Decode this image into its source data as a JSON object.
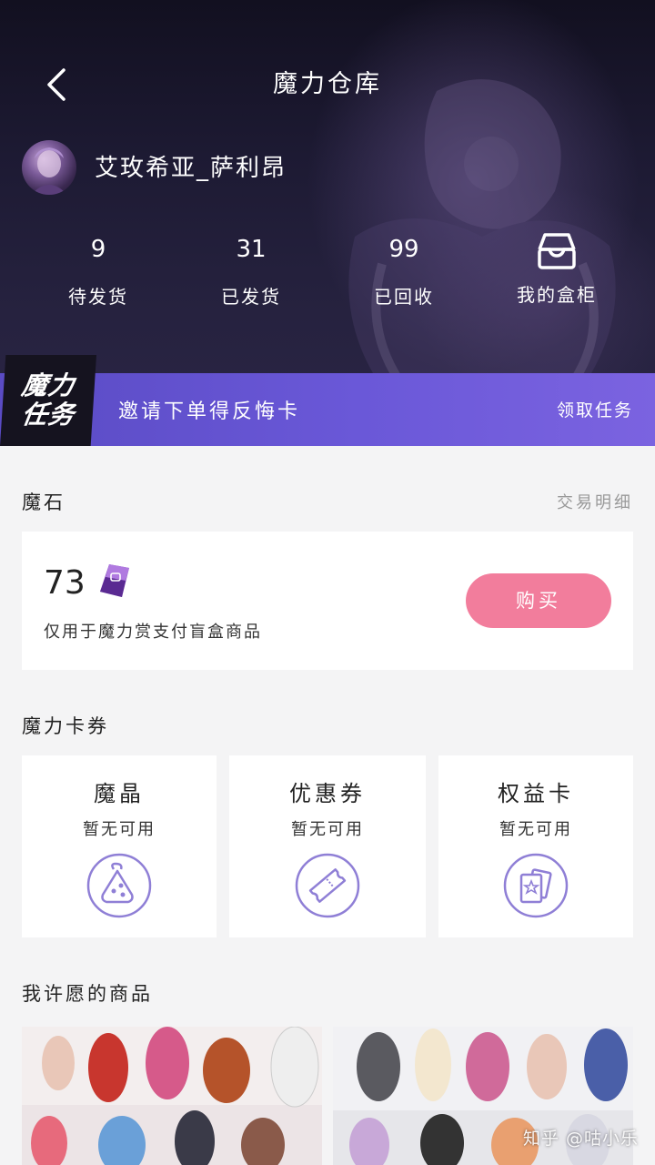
{
  "header": {
    "title": "魔力仓库",
    "username": "艾玫希亚_萨利昂"
  },
  "stats": [
    {
      "value": "9",
      "label": "待发货"
    },
    {
      "value": "31",
      "label": "已发货"
    },
    {
      "value": "99",
      "label": "已回收"
    }
  ],
  "cabinet_label": "我的盒柜",
  "task_banner": {
    "badge_line1": "魔力",
    "badge_line2": "任务",
    "text": "邀请下单得反悔卡",
    "link": "领取任务"
  },
  "magic_stone": {
    "section_title": "魔石",
    "detail_link": "交易明细",
    "amount": "73",
    "description": "仅用于魔力赏支付盲盒商品",
    "buy_label": "购买"
  },
  "coupons": {
    "section_title": "魔力卡券",
    "cards": [
      {
        "title": "魔晶",
        "status": "暂无可用",
        "icon": "crystal-bag-icon"
      },
      {
        "title": "优惠券",
        "status": "暂无可用",
        "icon": "ticket-icon"
      },
      {
        "title": "权益卡",
        "status": "暂无可用",
        "icon": "star-card-icon"
      }
    ]
  },
  "wishlist": {
    "section_title": "我许愿的商品"
  },
  "watermark": "知乎 @咕小乐",
  "colors": {
    "accent_purple": "#6a58d8",
    "buy_pink": "#f27d9c",
    "icon_purple": "#8f7fd6"
  }
}
